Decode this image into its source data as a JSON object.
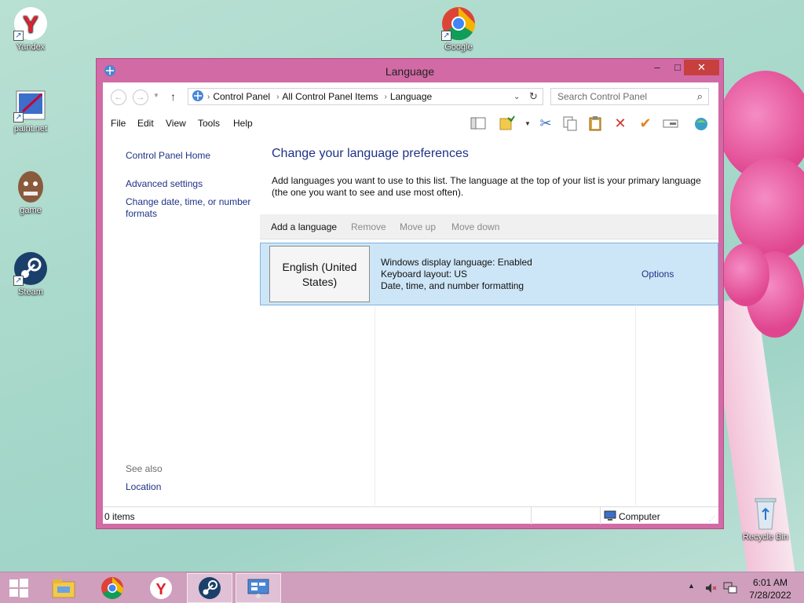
{
  "desktop": {
    "icons": [
      {
        "label": "Yandex"
      },
      {
        "label": "Google"
      },
      {
        "label": "paint.net"
      },
      {
        "label": "game"
      },
      {
        "label": "Steam"
      },
      {
        "label": "Recycle Bin"
      }
    ]
  },
  "window": {
    "title": "Language",
    "controls": {
      "minimize": "–",
      "maximize": "□",
      "close": "✕"
    },
    "address": {
      "segments": [
        "Control Panel",
        "All Control Panel Items",
        "Language"
      ],
      "search_placeholder": "Search Control Panel"
    },
    "menu": [
      "File",
      "Edit",
      "View",
      "Tools",
      "Help"
    ],
    "left_pane": {
      "home": "Control Panel Home",
      "links": [
        "Advanced settings",
        "Change date, time, or number formats"
      ],
      "see_also_label": "See also",
      "see_also_links": [
        "Location"
      ]
    },
    "main": {
      "heading": "Change your language preferences",
      "description": "Add languages you want to use to this list. The language at the top of your list is your primary language (the one you want to see and use most often).",
      "commands": [
        "Add a language",
        "Remove",
        "Move up",
        "Move down"
      ],
      "languages": [
        {
          "name": "English (United States)",
          "details": [
            "Windows display language: Enabled",
            "Keyboard layout: US",
            "Date, time, and number formatting"
          ],
          "options_label": "Options"
        }
      ]
    },
    "status": {
      "items": "0 items",
      "location": "Computer"
    }
  },
  "taskbar": {
    "clock_time": "6:01 AM",
    "clock_date": "7/28/2022"
  },
  "colors": {
    "window_frame": "#d26aa5",
    "link_blue": "#1e3287",
    "selection": "#cde6f7",
    "close_red": "#c7403d",
    "taskbar": "#cf9fbd"
  }
}
